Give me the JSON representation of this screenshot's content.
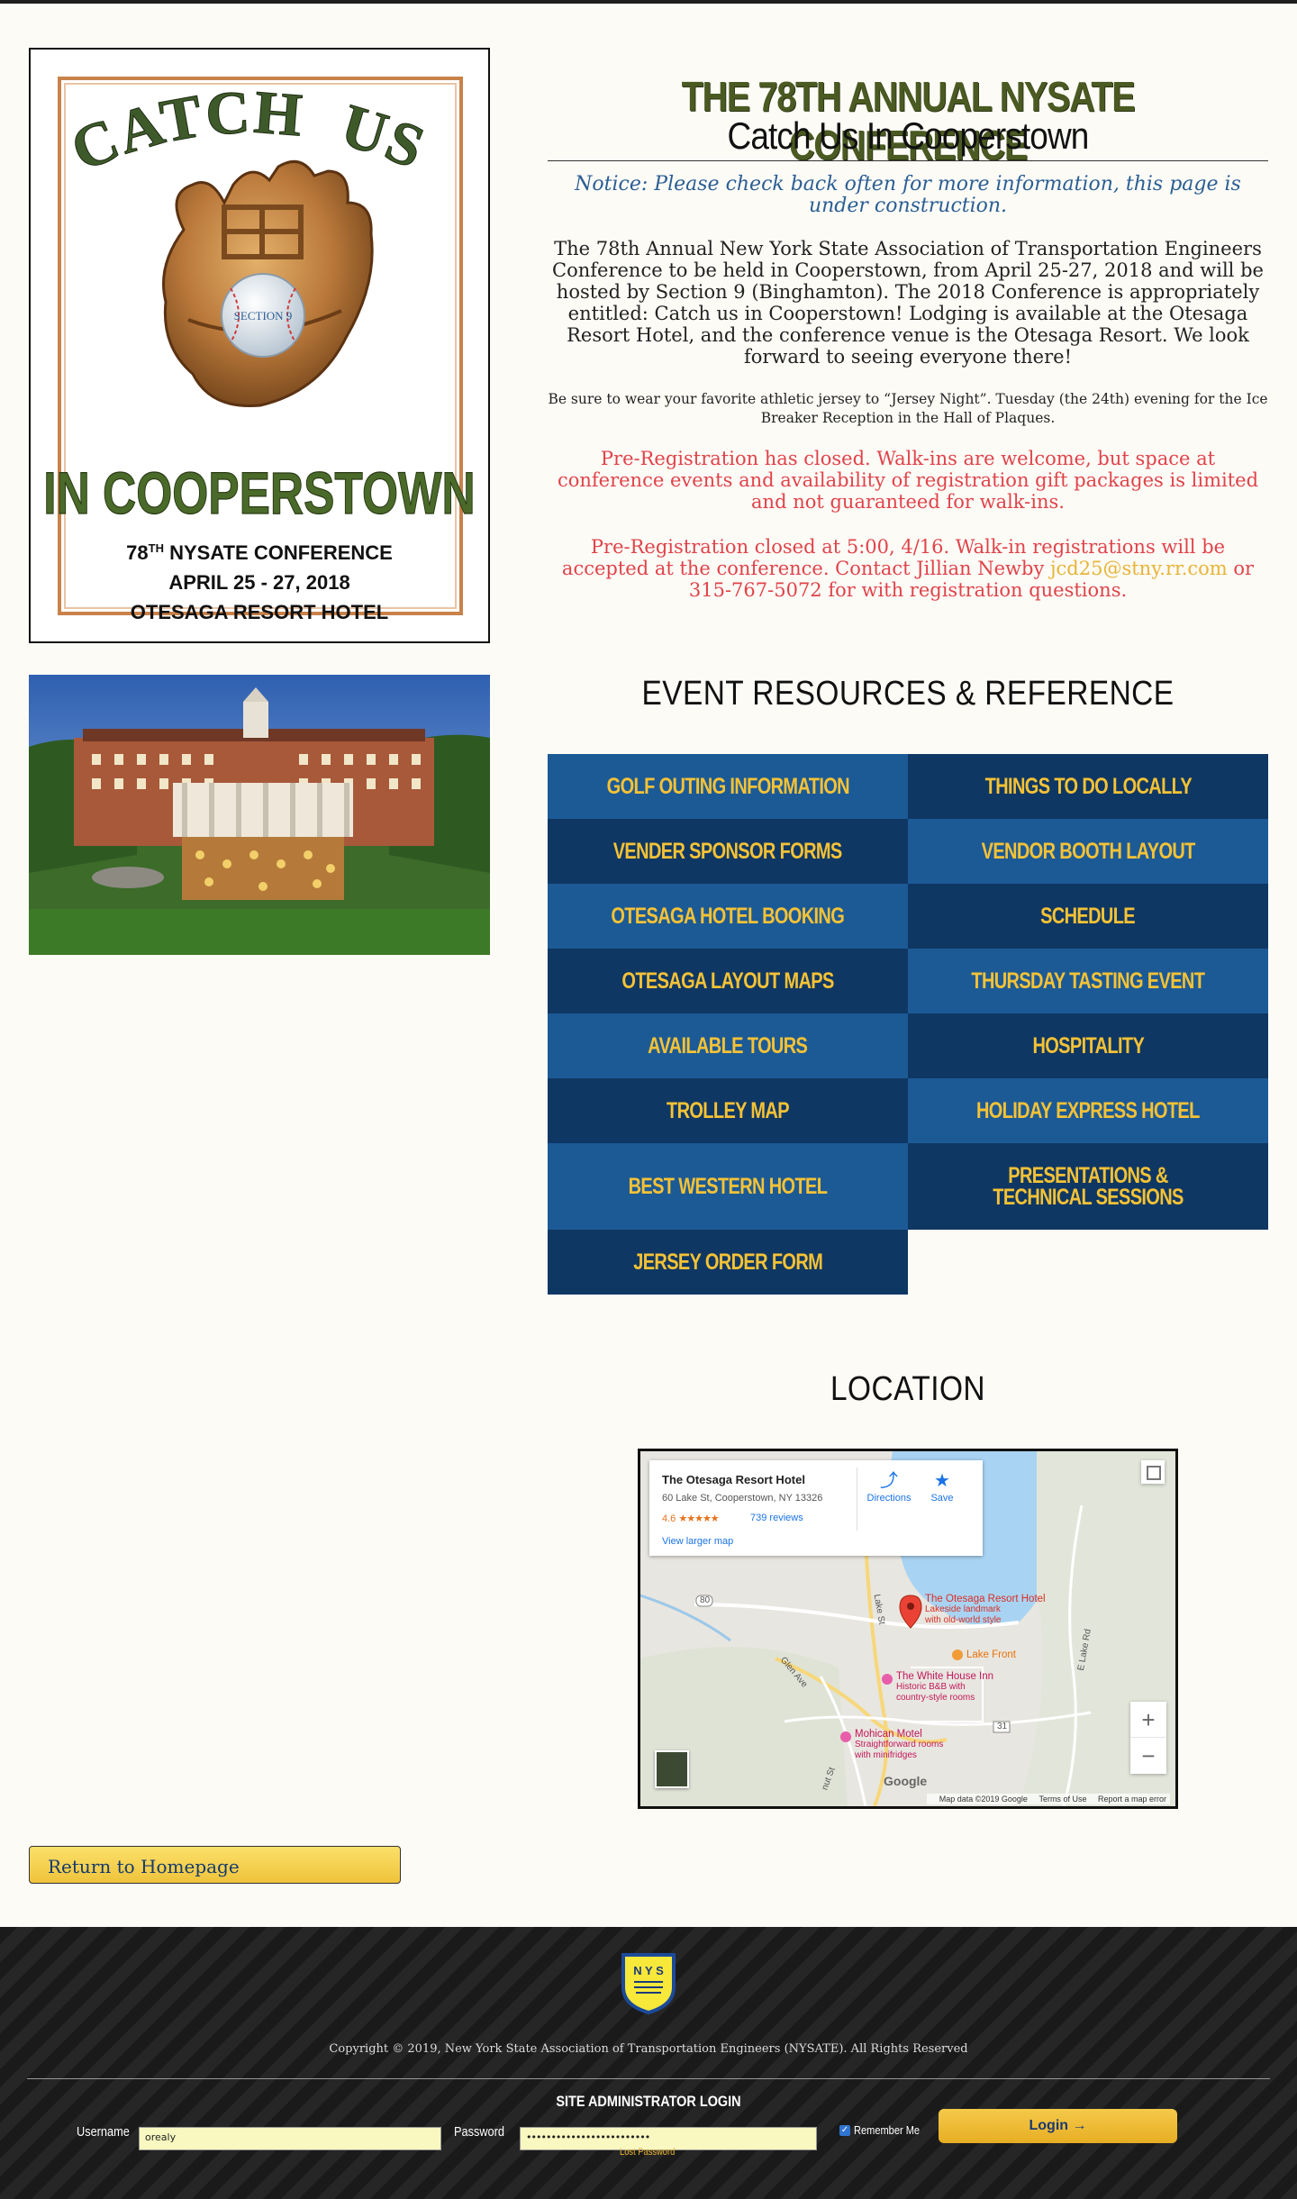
{
  "poster": {
    "catch": "CATCH",
    "us": "US",
    "ball_label": "SECTION 9",
    "in_cooperstown": "IN COOPERSTOWN",
    "conference_prefix": "78",
    "conference_sup": "TH",
    "conference_suffix": "NYSATE CONFERENCE",
    "dates": "APRIL 25 - 27, 2018",
    "venue": "OTESAGA RESORT HOTEL"
  },
  "header": {
    "title": "THE 78TH ANNUAL NYSATE CONFERENCE",
    "subtitle": "Catch Us In Cooperstown"
  },
  "notice": "Notice: Please check back often for more information, this page is under construction.",
  "intro": "The 78th Annual New York State Association of Transportation Engineers Conference to be held in Cooperstown, from April 25-27, 2018 and will be hosted by Section 9 (Binghamton). The 2018 Conference is appropriately entitled: Catch us in Cooperstown! Lodging is available at the Otesaga Resort Hotel, and the conference venue is the Otesaga Resort. We look forward to seeing everyone there!",
  "jersey_note": "Be sure to wear your favorite athletic jersey to “Jersey Night”. Tuesday (the 24th) evening for the Ice Breaker Reception in the Hall of Plaques.",
  "prereg_closed": "Pre-Registration has closed. Walk-ins are welcome, but space at conference events and availability of registration gift packages is limited and not guaranteed for walk-ins.",
  "prereg_contact": {
    "before": "Pre-Registration closed at 5:00, 4/16. Walk-in registrations will be accepted at the conference. Contact Jillian Newby ",
    "email": "jcd25@stny.rr.com",
    "after": " or 315-767-5072 for with registration questions."
  },
  "resources": {
    "heading": "EVENT RESOURCES & REFERENCE",
    "items": [
      {
        "label": "GOLF OUTING INFORMATION"
      },
      {
        "label": "THINGS TO DO LOCALLY"
      },
      {
        "label": "VENDER SPONSOR FORMS"
      },
      {
        "label": "VENDOR BOOTH LAYOUT"
      },
      {
        "label": "OTESAGA HOTEL BOOKING"
      },
      {
        "label": "SCHEDULE"
      },
      {
        "label": "OTESAGA LAYOUT MAPS"
      },
      {
        "label": "THURSDAY TASTING EVENT"
      },
      {
        "label": "AVAILABLE TOURS"
      },
      {
        "label": "HOSPITALITY"
      },
      {
        "label": "TROLLEY MAP"
      },
      {
        "label": "HOLIDAY EXPRESS HOTEL"
      },
      {
        "label": "BEST WESTERN HOTEL"
      },
      {
        "label": "PRESENTATIONS & TECHNICAL SESSIONS"
      },
      {
        "label": "JERSEY ORDER FORM"
      }
    ]
  },
  "location": {
    "heading": "LOCATION",
    "card": {
      "name": "The Otesaga Resort Hotel",
      "address": "60 Lake St, Cooperstown, NY 13326",
      "rating": "4.6",
      "stars": "★★★★★",
      "reviews": "739 reviews",
      "view_larger": "View larger map",
      "directions": "Directions",
      "save": "Save"
    },
    "places": {
      "otesaga_name": "The Otesaga Resort Hotel",
      "otesaga_desc1": "Lakeside landmark",
      "otesaga_desc2": "with old-world style",
      "lake_front": "Lake Front",
      "white_house_name": "The White House Inn",
      "white_house_desc1": "Historic B&B with",
      "white_house_desc2": "country-style rooms",
      "mohican_name": "Mohican Motel",
      "mohican_desc1": "Straightforward rooms",
      "mohican_desc2": "with minifridges"
    },
    "roads": {
      "lake_st": "Lake St",
      "glen_ave": "Glen Ave",
      "e_lake_rd": "E Lake Rd",
      "route_80": "80",
      "route_31": "31",
      "chestnut": "nut St"
    },
    "google": "Google",
    "footer": {
      "data": "Map data ©2019 Google",
      "terms": "Terms of Use",
      "report": "Report a map error"
    },
    "zoom_in": "+",
    "zoom_out": "−"
  },
  "return_button": "Return to Homepage",
  "footer": {
    "logo_text": "N Y S",
    "copyright": "Copyright © 2019, New York State Association of Transportation Engineers (NYSATE). All Rights Reserved",
    "admin_title": "SITE ADMINISTRATOR LOGIN",
    "username_label": "Username",
    "username_value": "orealy",
    "password_label": "Password",
    "password_value": "•••••••••••••••••••••••••",
    "lost_password": "Lost Password",
    "remember_me": "Remember Me",
    "login_button": "Login →"
  },
  "colors": {
    "tile_light": "#1c5a96",
    "tile_dark": "#0f3763",
    "tile_text": "#f5c236",
    "alert_red": "#e0434a",
    "notice_blue": "#2b5e94",
    "title_green": "#4a5a22"
  }
}
